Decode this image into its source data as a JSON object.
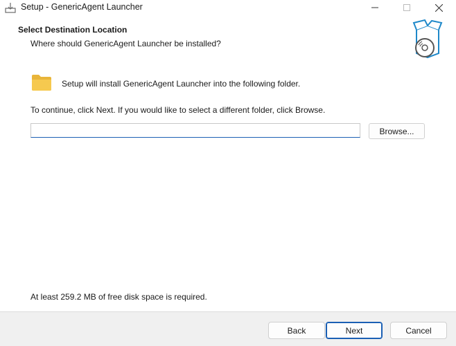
{
  "window": {
    "title": "Setup - GenericAgent Launcher",
    "controls": [
      "minimize-icon",
      "maximize-icon",
      "close-icon"
    ]
  },
  "header": {
    "title": "Select Destination Location",
    "subtitle": "Where should GenericAgent Launcher be installed?",
    "image_icon": "install-box-disc-icon"
  },
  "content": {
    "folder_icon": "folder-icon",
    "intro": "Setup will install GenericAgent Launcher into the following folder.",
    "instruction": "To continue, click Next. If you would like to select a different folder, click Browse.",
    "path_value": "",
    "browse_label": "Browse...",
    "disk_space": "At least 259.2 MB of free disk space is required."
  },
  "footer": {
    "back_label": "Back",
    "next_label": "Next",
    "cancel_label": "Cancel"
  },
  "colors": {
    "accent": "#1a5fb4",
    "footer_bg": "#f0f0f0",
    "icon_blue": "#1e88c9",
    "folder_yellow": "#f6c94f"
  }
}
